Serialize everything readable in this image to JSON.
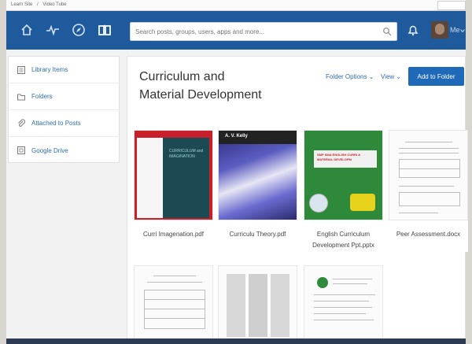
{
  "browser": {
    "breadcrumb": [
      "Learn Site",
      "/",
      "Video Tube"
    ]
  },
  "nav": {
    "search_placeholder": "Search posts, groups, users, apps and more...",
    "me_label": "Me"
  },
  "sidebar": {
    "items": [
      {
        "label": "Library Items",
        "icon": "library-icon"
      },
      {
        "label": "Folders",
        "icon": "folder-icon"
      },
      {
        "label": "Attached to Posts",
        "icon": "paperclip-icon"
      },
      {
        "label": "Google Drive",
        "icon": "drive-icon"
      }
    ]
  },
  "main": {
    "title_line1": "Curriculum and",
    "title_line2": "Material Development",
    "folder_options": "Folder Options ⌄",
    "view": "View ⌄",
    "add_button": "Add to Folder",
    "files": [
      {
        "name": "Curri Imagenation.pdf",
        "thumb_text": "CURRICULUM and IMAGINATION"
      },
      {
        "name": "Curriculu Theory.pdf",
        "thumb_text": "A. V. Kelly"
      },
      {
        "name": "English Curriculum Development Ppt.pptx",
        "thumb_text": "SMP SMA ENGLISH CURRI & MATERIAL DEVELOPM"
      },
      {
        "name": "Peer Assessment.docx"
      },
      {
        "name": ""
      },
      {
        "name": ""
      },
      {
        "name": ""
      }
    ]
  },
  "colors": {
    "nav_bg": "#1e5a9c",
    "accent": "#1e6ab8",
    "link": "#2f6db0"
  }
}
